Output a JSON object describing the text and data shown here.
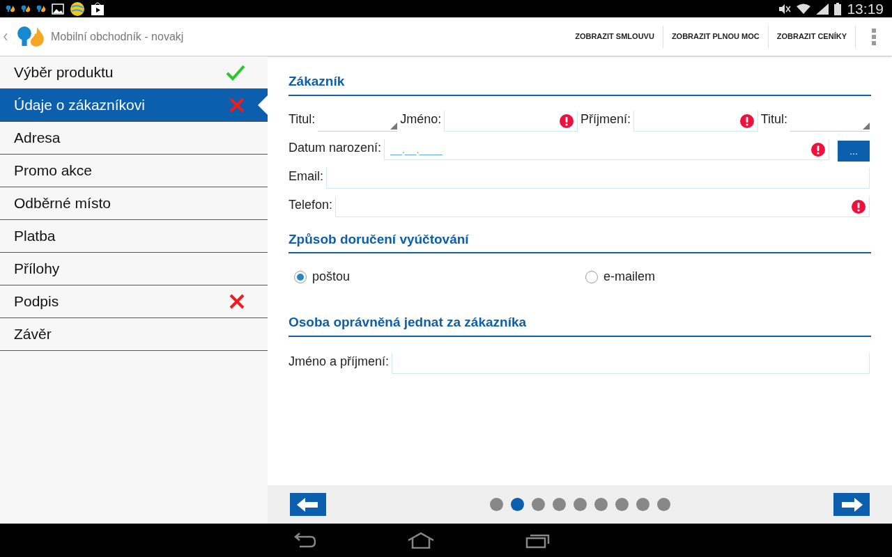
{
  "status_bar": {
    "time": "13:19"
  },
  "app_bar": {
    "title": "Mobilní obchodník - novakj",
    "actions": [
      "ZOBRAZIT SMLOUVU",
      "ZOBRAZIT PLNOU MOC",
      "ZOBRAZIT CENÍKY"
    ]
  },
  "sidebar": {
    "items": [
      {
        "label": "Výběr produktu",
        "selected": false,
        "kind": "done"
      },
      {
        "label": "Údaje o zákazníkovi",
        "selected": true,
        "kind": "invalid"
      },
      {
        "label": "Adresa",
        "selected": false,
        "kind": "plain"
      },
      {
        "label": "Promo akce",
        "selected": false,
        "kind": "plain"
      },
      {
        "label": "Odběrné místo",
        "selected": false,
        "kind": "plain"
      },
      {
        "label": "Platba",
        "selected": false,
        "kind": "plain"
      },
      {
        "label": "Přílohy",
        "selected": false,
        "kind": "plain"
      },
      {
        "label": "Podpis",
        "selected": false,
        "kind": "invalid"
      },
      {
        "label": "Závěr",
        "selected": false,
        "kind": "plain"
      }
    ]
  },
  "customer": {
    "heading": "Zákazník",
    "rows": [
      [
        {
          "label": "Titul:",
          "kind": "select"
        },
        {
          "label": "Jméno:",
          "kind": "text",
          "required": true
        },
        {
          "label": "Příjmení:",
          "kind": "text",
          "required": true
        },
        {
          "label": "Titul:",
          "kind": "select"
        }
      ],
      [
        {
          "label": "Datum narození:",
          "kind": "date",
          "required": true,
          "placeholder": "__.__.____",
          "button": "..."
        }
      ],
      [
        {
          "label": "Email:",
          "kind": "text",
          "required": false
        }
      ],
      [
        {
          "label": "Telefon:",
          "kind": "text",
          "required": true
        }
      ]
    ]
  },
  "billing_delivery": {
    "heading": "Způsob doručení vyúčtování",
    "options": [
      {
        "label": "poštou",
        "selected": true
      },
      {
        "label": "e-mailem",
        "selected": false
      }
    ]
  },
  "authorized_person": {
    "heading": "Osoba oprávněná jednat za zákazníka",
    "fields": [
      {
        "label": "Jméno a příjmení:",
        "kind": "text",
        "required": false
      }
    ]
  },
  "pager": {
    "dots": [
      {
        "selected": false
      },
      {
        "selected": true
      },
      {
        "selected": false
      },
      {
        "selected": false
      },
      {
        "selected": false
      },
      {
        "selected": false
      },
      {
        "selected": false
      },
      {
        "selected": false
      },
      {
        "selected": false
      }
    ]
  }
}
